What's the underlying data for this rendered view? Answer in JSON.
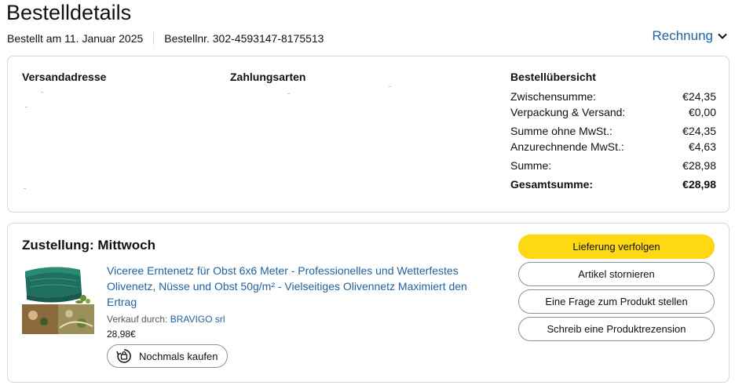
{
  "page": {
    "title": "Bestelldetails",
    "ordered_on": "Bestellt am 11. Januar 2025",
    "order_number": "Bestellnr. 302-4593147-8175513",
    "invoice_label": "Rechnung"
  },
  "summary_card": {
    "shipping_heading": "Versandadresse",
    "payment_heading": "Zahlungsarten",
    "overview_heading": "Bestellübersicht",
    "rows": [
      {
        "label": "Zwischensumme:",
        "value": "€24,35"
      },
      {
        "label": "Verpackung & Versand:",
        "value": "€0,00"
      },
      {
        "label": "Summe ohne MwSt.:",
        "value": "€24,35"
      },
      {
        "label": "Anzurechnende MwSt.:",
        "value": "€4,63"
      },
      {
        "label": "Summe:",
        "value": "€28,98"
      },
      {
        "label": "Gesamtsumme:",
        "value": "€28,98"
      }
    ]
  },
  "delivery": {
    "title": "Zustellung: Mittwoch",
    "product_title": "Viceree Erntenetz für Obst 6x6 Meter - Professionelles und Wetterfestes Olivenetz, Nüsse und Obst 50g/m² - Vielseitiges Olivennetz Maximiert den Ertrag",
    "seller_prefix": "Verkauf durch:",
    "seller_name": "BRAVIGO srl",
    "price": "28,98€",
    "buy_again_label": "Nochmals kaufen",
    "actions": [
      "Lieferung verfolgen",
      "Artikel stornieren",
      "Eine Frage zum Produkt stellen",
      "Schreib eine Produktrezension"
    ]
  },
  "colors": {
    "link": "#2162a1",
    "primary_button": "#ffd814",
    "border": "#d5d9d9",
    "net_green": "#1f6e5e"
  }
}
